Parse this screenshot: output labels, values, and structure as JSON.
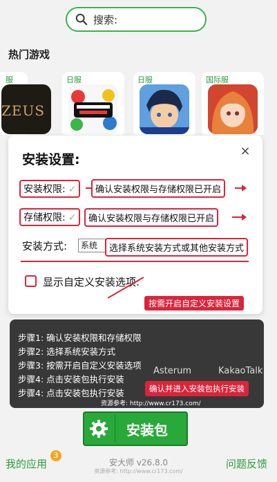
{
  "search": {
    "placeholder": "搜索:"
  },
  "section_title": "热门游戏",
  "games": [
    {
      "tag": "服",
      "art": "ZEUS"
    },
    {
      "tag": "日服"
    },
    {
      "tag": "日服"
    },
    {
      "tag": "国际服"
    }
  ],
  "modal": {
    "title": "安装设置:",
    "close": "×",
    "install_perm_label": "安装权限:",
    "install_perm_note": "确认安装权限与存储权限已开启",
    "storage_perm_label": "存储权限:",
    "storage_perm_note": "确认安装权限与存储权限已开启",
    "method_label": "安装方式:",
    "method_value": "系统",
    "method_note": "选择系统安装方式或其他安装方式",
    "custom_option_label": "显示自定义安装选项:",
    "check_mark": "✓"
  },
  "custom_note": "按需开启自定义安装设置",
  "steps": [
    "步骤1: 确认安装权限和存储权限",
    "步骤2: 选择系统安装方式",
    "步骤3: 按需开启自定义安装选项",
    "步骤4: 点击安装包执行安装",
    "步骤4: 点击安装包执行安装"
  ],
  "steps_ref": "资源参考: http://www.cr173.com/",
  "exec_note": "确认并进入安装包执行安装",
  "bg_apps": [
    "Asterum",
    "KakaoTalk"
  ],
  "install_button": "安装包",
  "footer": {
    "my_apps": "我的应用",
    "badge": "3",
    "version": "安大师 v26.8.0",
    "ref": "资源参考: http://www.cr173.com/",
    "feedback": "问题反馈"
  },
  "colors": {
    "accent": "#37b34a",
    "annotation": "#d9253b"
  }
}
